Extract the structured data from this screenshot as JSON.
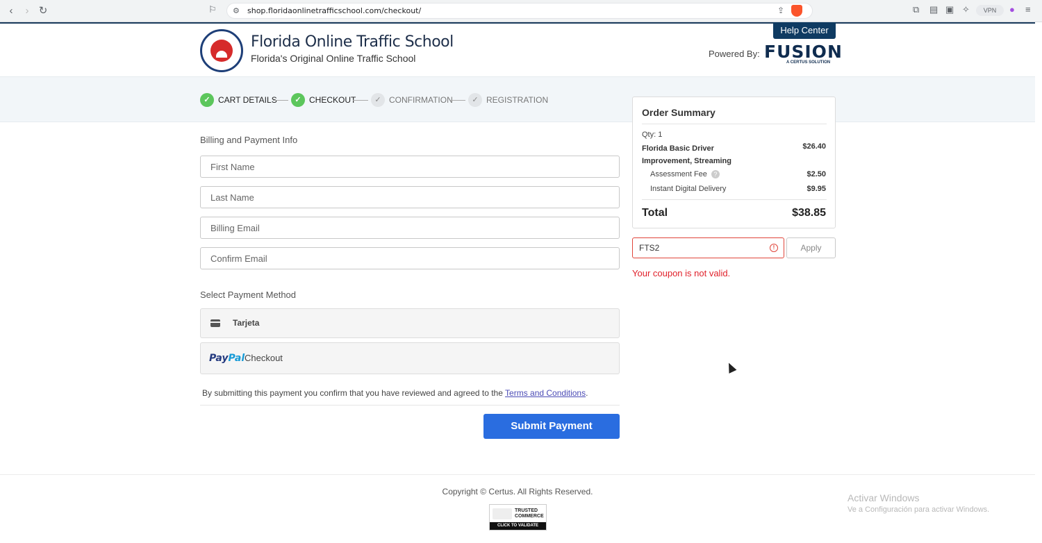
{
  "browser": {
    "url": "shop.floridaonlinetrafficschool.com/checkout/",
    "vpn_label": "VPN"
  },
  "header": {
    "brand_title": "Florida Online Traffic School",
    "brand_subtitle": "Florida's Original Online Traffic School",
    "help_center": "Help Center",
    "powered_by": "Powered By:",
    "partner_name": "FUSION",
    "partner_tagline": "A CERTUS SOLUTION"
  },
  "steps": [
    {
      "label": "CART DETAILS",
      "status": "done"
    },
    {
      "label": "CHECKOUT",
      "status": "done"
    },
    {
      "label": "CONFIRMATION",
      "status": "todo"
    },
    {
      "label": "REGISTRATION",
      "status": "todo"
    }
  ],
  "billing": {
    "section_label": "Billing and Payment Info",
    "first_name_placeholder": "First Name",
    "last_name_placeholder": "Last Name",
    "email_placeholder": "Billing Email",
    "confirm_email_placeholder": "Confirm Email"
  },
  "payment": {
    "section_label": "Select Payment Method",
    "card_label": "Tarjeta",
    "paypal_brand_1": "Pay",
    "paypal_brand_2": "Pal",
    "paypal_label": "Checkout"
  },
  "terms": {
    "text": "By submitting this payment you confirm that you have reviewed and agreed to the ",
    "link": "Terms and Conditions",
    "suffix": "."
  },
  "submit_label": "Submit Payment",
  "summary": {
    "title": "Order Summary",
    "qty": "Qty: 1",
    "product_name": "Florida Basic Driver Improvement, Streaming",
    "product_price": "$26.40",
    "fee_label": "Assessment Fee",
    "fee_price": "$2.50",
    "delivery_label": "Instant Digital Delivery",
    "delivery_price": "$9.95",
    "total_label": "Total",
    "total_value": "$38.85"
  },
  "coupon": {
    "value": "FTS2",
    "apply_label": "Apply",
    "error": "Your coupon is not valid."
  },
  "footer": {
    "copyright": "Copyright © Certus. All Rights Reserved.",
    "trust_line1": "TRUSTED",
    "trust_line2": "COMMERCE",
    "trust_validate": "CLICK TO VALIDATE"
  },
  "windows": {
    "activate_title": "Activar Windows",
    "activate_sub": "Ve a Configuración para activar Windows."
  },
  "colors": {
    "primary_button": "#2a6de0",
    "brand_navy": "#0f3b62",
    "step_done": "#5cc65c",
    "error": "#e0202a"
  }
}
